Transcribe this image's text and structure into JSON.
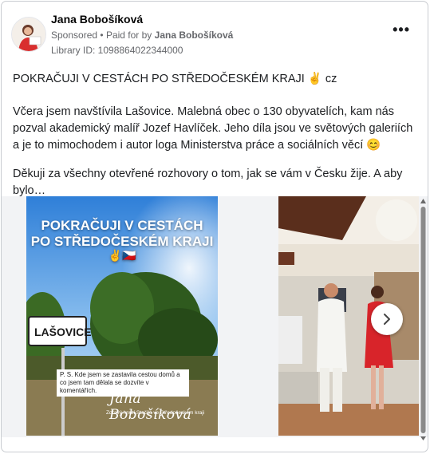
{
  "post": {
    "author": "Jana Bobošíková",
    "sponsored": "Sponsored",
    "paid_for_prefix": "Paid for by",
    "paid_for_name": "Jana Bobošíková",
    "library_id": "Library ID: 1098864022344000",
    "more_label": "•••",
    "text_line1": "POKRAČUJI V CESTÁCH PO STŘEDOČESKÉM KRAJI ✌️ cz",
    "text_line2": "Včera jsem navštívila Lašovice. Malebná obec o 130 obyvatelích, kam nás pozval akademický malíř Jozef Havlíček. Jeho díla jsou ve světových galeriích a je to mimochodem i autor loga Ministerstva práce a sociálních věcí 😊",
    "text_line3": "Děkuji za všechny otevřené rozhovory o tom, jak se vám v Česku žije. A aby bylo…"
  },
  "carousel": {
    "slide1": {
      "title_line1": "POKRAČUJI V CESTÁCH",
      "title_line2": "PO STŘEDOČESKÉM KRAJI",
      "title_emoji": "✌️🇨🇿",
      "sign": "LAŠOVICE",
      "ps_text": "P. S. Kde jsem se zastavila cestou domů a co jsem tam dělala se dozvíte v komentářích.",
      "signature": "Jana Bobošíková",
      "signature_sub": "Zdravý hnutí Stačilo ve Středočeském kraji"
    }
  },
  "colors": {
    "text_primary": "#1c1e21",
    "text_secondary": "#65676b",
    "border": "#c9ccd1",
    "carousel_bg": "#f2f3f5"
  }
}
